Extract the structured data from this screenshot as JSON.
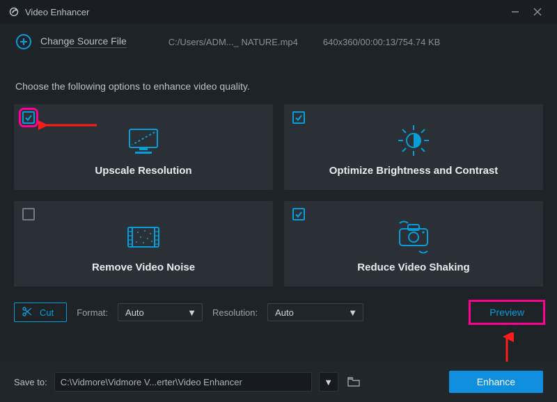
{
  "window": {
    "title": "Video Enhancer"
  },
  "source": {
    "change_label": "Change Source File",
    "path": "C:/Users/ADM..._ NATURE.mp4",
    "meta": "640x360/00:00:13/754.74 KB"
  },
  "instruction": "Choose the following options to enhance video quality.",
  "cards": {
    "upscale": {
      "label": "Upscale Resolution",
      "checked": true
    },
    "brightness": {
      "label": "Optimize Brightness and Contrast",
      "checked": true
    },
    "noise": {
      "label": "Remove Video Noise",
      "checked": false
    },
    "shaking": {
      "label": "Reduce Video Shaking",
      "checked": true
    }
  },
  "controls": {
    "cut_label": "Cut",
    "format_label": "Format:",
    "format_value": "Auto",
    "resolution_label": "Resolution:",
    "resolution_value": "Auto",
    "preview_label": "Preview"
  },
  "save": {
    "label": "Save to:",
    "path": "C:\\Vidmore\\Vidmore V...erter\\Video Enhancer"
  },
  "actions": {
    "enhance_label": "Enhance"
  },
  "palette": {
    "accent": "#079dd9",
    "highlight": "#ff0090"
  }
}
